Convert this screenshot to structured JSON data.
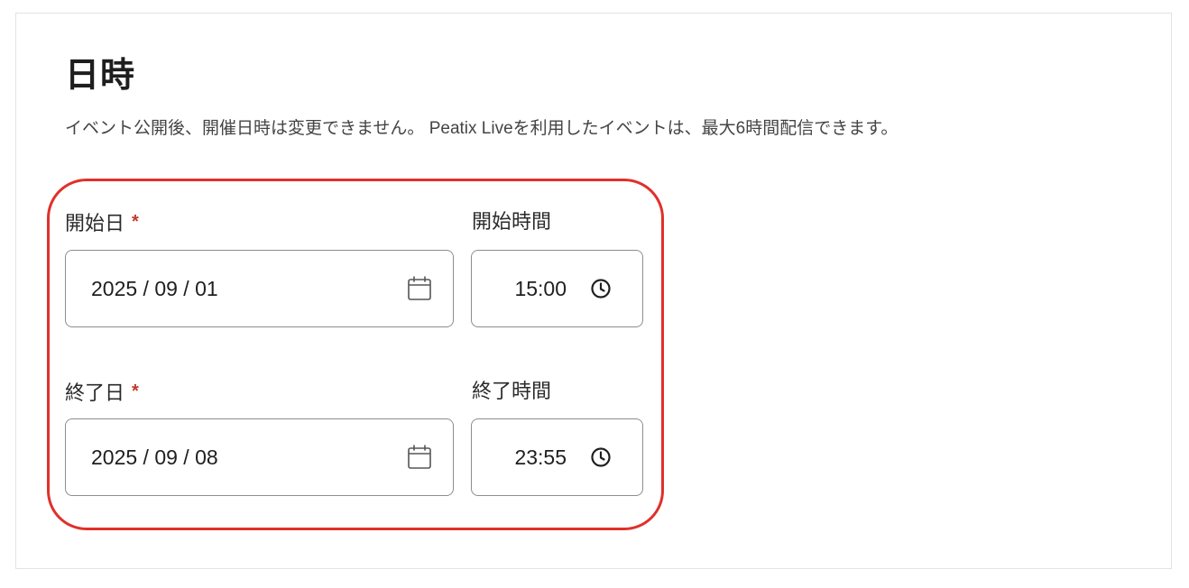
{
  "section": {
    "title": "日時",
    "description": "イベント公開後、開催日時は変更できません。 Peatix Liveを利用したイベントは、最大6時間配信できます。"
  },
  "fields": {
    "start_date": {
      "label": "開始日",
      "required_mark": "*",
      "value": "2025 / 09 / 01",
      "icon": "calendar-icon"
    },
    "start_time": {
      "label": "開始時間",
      "value": "15:00",
      "icon": "clock-icon"
    },
    "end_date": {
      "label": "終了日",
      "required_mark": "*",
      "value": "2025 / 09 / 08",
      "icon": "calendar-icon"
    },
    "end_time": {
      "label": "終了時間",
      "value": "23:55",
      "icon": "clock-icon"
    }
  },
  "colors": {
    "required_mark": "#c0392b",
    "highlight_outline": "#e0302a",
    "input_border": "#8d8d8d"
  }
}
